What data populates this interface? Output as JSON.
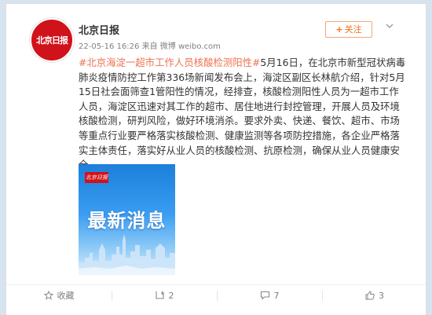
{
  "post": {
    "author": {
      "name": "北京日报",
      "avatar_text": "北京日报"
    },
    "follow_label": "关注",
    "timestamp": "22-05-16 16:26",
    "source_prefix": "来自",
    "source": "微博 weibo.com",
    "topic": "#北京海淀一超市工作人员核酸检测阳性#",
    "body": "5月16日，在北京市新型冠状病毒肺炎疫情防控工作第336场新闻发布会上，海淀区副区长林航介绍，针对5月15日社会面筛查1管阳性的情况，经排查，核酸检测阳性人员为一超市工作人员，海淀区迅速对其工作的超市、居住地进行封控管理，开展人员及环境核酸检测，研判风险，做好环境消杀。要求外卖、快递、餐饮、超市、市场等重点行业要严格落实核酸检测、健康监测等各项防控措施，各企业严格落实主体责任，落实好从业人员的核酸检测、抗原检测，确保从业人员健康安全。",
    "image": {
      "logo_text": "北京日报",
      "headline": "最新消息"
    }
  },
  "actions": {
    "favorite_label": "收藏",
    "repost_count": "2",
    "comment_count": "7",
    "like_count": "3"
  },
  "colors": {
    "accent": "#eb7350",
    "follow": "#f46d1b",
    "brand_red": "#d0121b"
  }
}
